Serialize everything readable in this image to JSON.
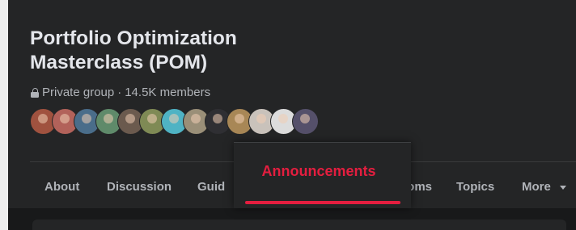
{
  "group": {
    "title": "Portfolio Optimization Masterclass (POM)",
    "privacy": "Private group",
    "separator": "·",
    "members": "14.5K members",
    "lock_icon": "lock-icon"
  },
  "member_avatars": [
    {
      "color": "#a0523f"
    },
    {
      "color": "#b2625a"
    },
    {
      "color": "#4a6d8a"
    },
    {
      "color": "#5f8a6a"
    },
    {
      "color": "#6b5a4e"
    },
    {
      "color": "#7f8a55"
    },
    {
      "color": "#4fb3c4"
    },
    {
      "color": "#9a8f78"
    },
    {
      "color": "#2f2f33"
    },
    {
      "color": "#a88756"
    },
    {
      "color": "#c9c2bb"
    },
    {
      "color": "#dcdcdc"
    },
    {
      "color": "#55506a"
    }
  ],
  "tabs": [
    {
      "label": "About"
    },
    {
      "label": "Discussion"
    },
    {
      "label": "Guid"
    },
    {
      "label": "ooms"
    },
    {
      "label": "Topics"
    },
    {
      "label": "More"
    }
  ],
  "active_tab": {
    "label": "Announcements",
    "accent": "#e41e3f"
  }
}
